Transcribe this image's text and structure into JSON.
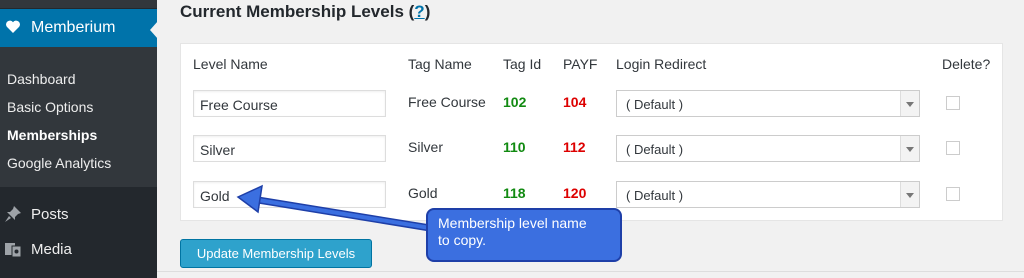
{
  "sidebar": {
    "active_item": "Memberium",
    "sub_items": [
      "Dashboard",
      "Basic Options",
      "Memberships",
      "Google Analytics"
    ],
    "current_sub": "Memberships",
    "menu_items": [
      {
        "label": "Posts",
        "icon": "pushpin-icon"
      },
      {
        "label": "Media",
        "icon": "media-icon"
      }
    ],
    "colors": {
      "bg": "#23282d",
      "active": "#0073aa"
    }
  },
  "main": {
    "title": "Current Membership Levels",
    "help_link": "?",
    "columns": [
      "Level Name",
      "Tag Name",
      "Tag Id",
      "PAYF",
      "Login Redirect",
      "Delete?"
    ],
    "rows": [
      {
        "level_name": "Free Course",
        "tag_name": "Free Course",
        "tag_id": "102",
        "payf": "104",
        "redirect": "( Default )"
      },
      {
        "level_name": "Silver",
        "tag_name": "Silver",
        "tag_id": "110",
        "payf": "112",
        "redirect": "( Default )"
      },
      {
        "level_name": "Gold",
        "tag_name": "Gold",
        "tag_id": "118",
        "payf": "120",
        "redirect": "( Default )"
      }
    ],
    "update_button": "Update Membership Levels"
  },
  "callout": {
    "text_line1": "Membership level name",
    "text_line2": "to copy."
  }
}
